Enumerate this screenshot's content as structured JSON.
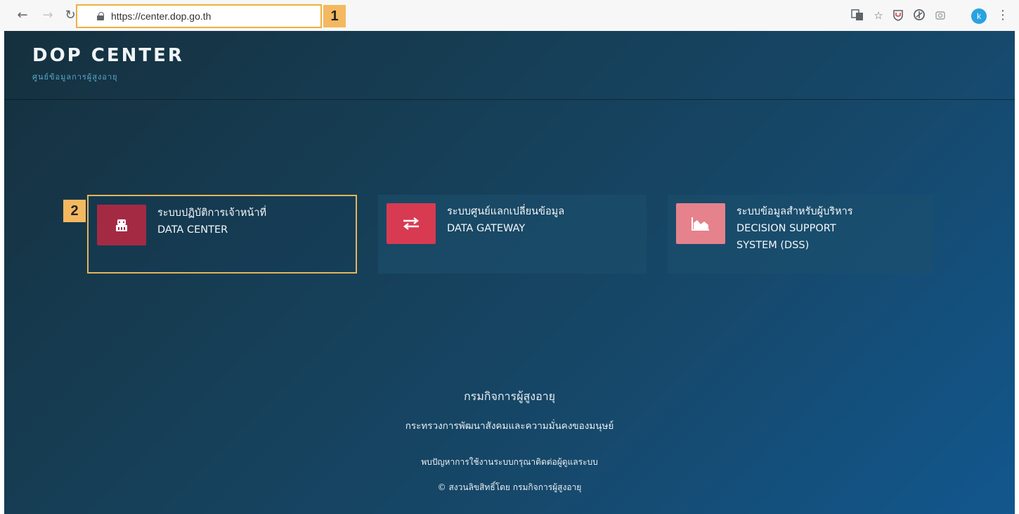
{
  "browser": {
    "url": "https://center.dop.go.th",
    "step_badges": [
      "1",
      "2"
    ],
    "avatar_letter": "k"
  },
  "site": {
    "title": "DOP CENTER",
    "subtitle": "ศูนย์ข้อมูลการผู้สูงอายุ"
  },
  "cards": [
    {
      "line1": "ระบบปฏิบัติการเจ้าหน้าที่",
      "line2": "DATA CENTER",
      "line3": "",
      "icon": "robot-icon",
      "color": "#a42a44"
    },
    {
      "line1": "ระบบศูนย์แลกเปลี่ยนข้อมูล",
      "line2": "DATA GATEWAY",
      "line3": "",
      "icon": "exchange-arrows-icon",
      "color": "#d83a52"
    },
    {
      "line1": "ระบบข้อมูลสำหรับผู้บริหาร",
      "line2": "DECISION SUPPORT",
      "line3": "SYSTEM (DSS)",
      "icon": "area-chart-icon",
      "color": "#e5828c"
    }
  ],
  "footer": {
    "org": "กรมกิจการผู้สูงอายุ",
    "ministry": "กระทรวงการพัฒนาสังคมและความมั่นคงของมนุษย์",
    "contact": "พบปัญหาการใช้งานระบบกรุณาติดต่อผู้ดูแลระบบ",
    "copyright": "© สงวนลิขสิทธิ์โดย กรมกิจการผู้สูงอายุ"
  }
}
